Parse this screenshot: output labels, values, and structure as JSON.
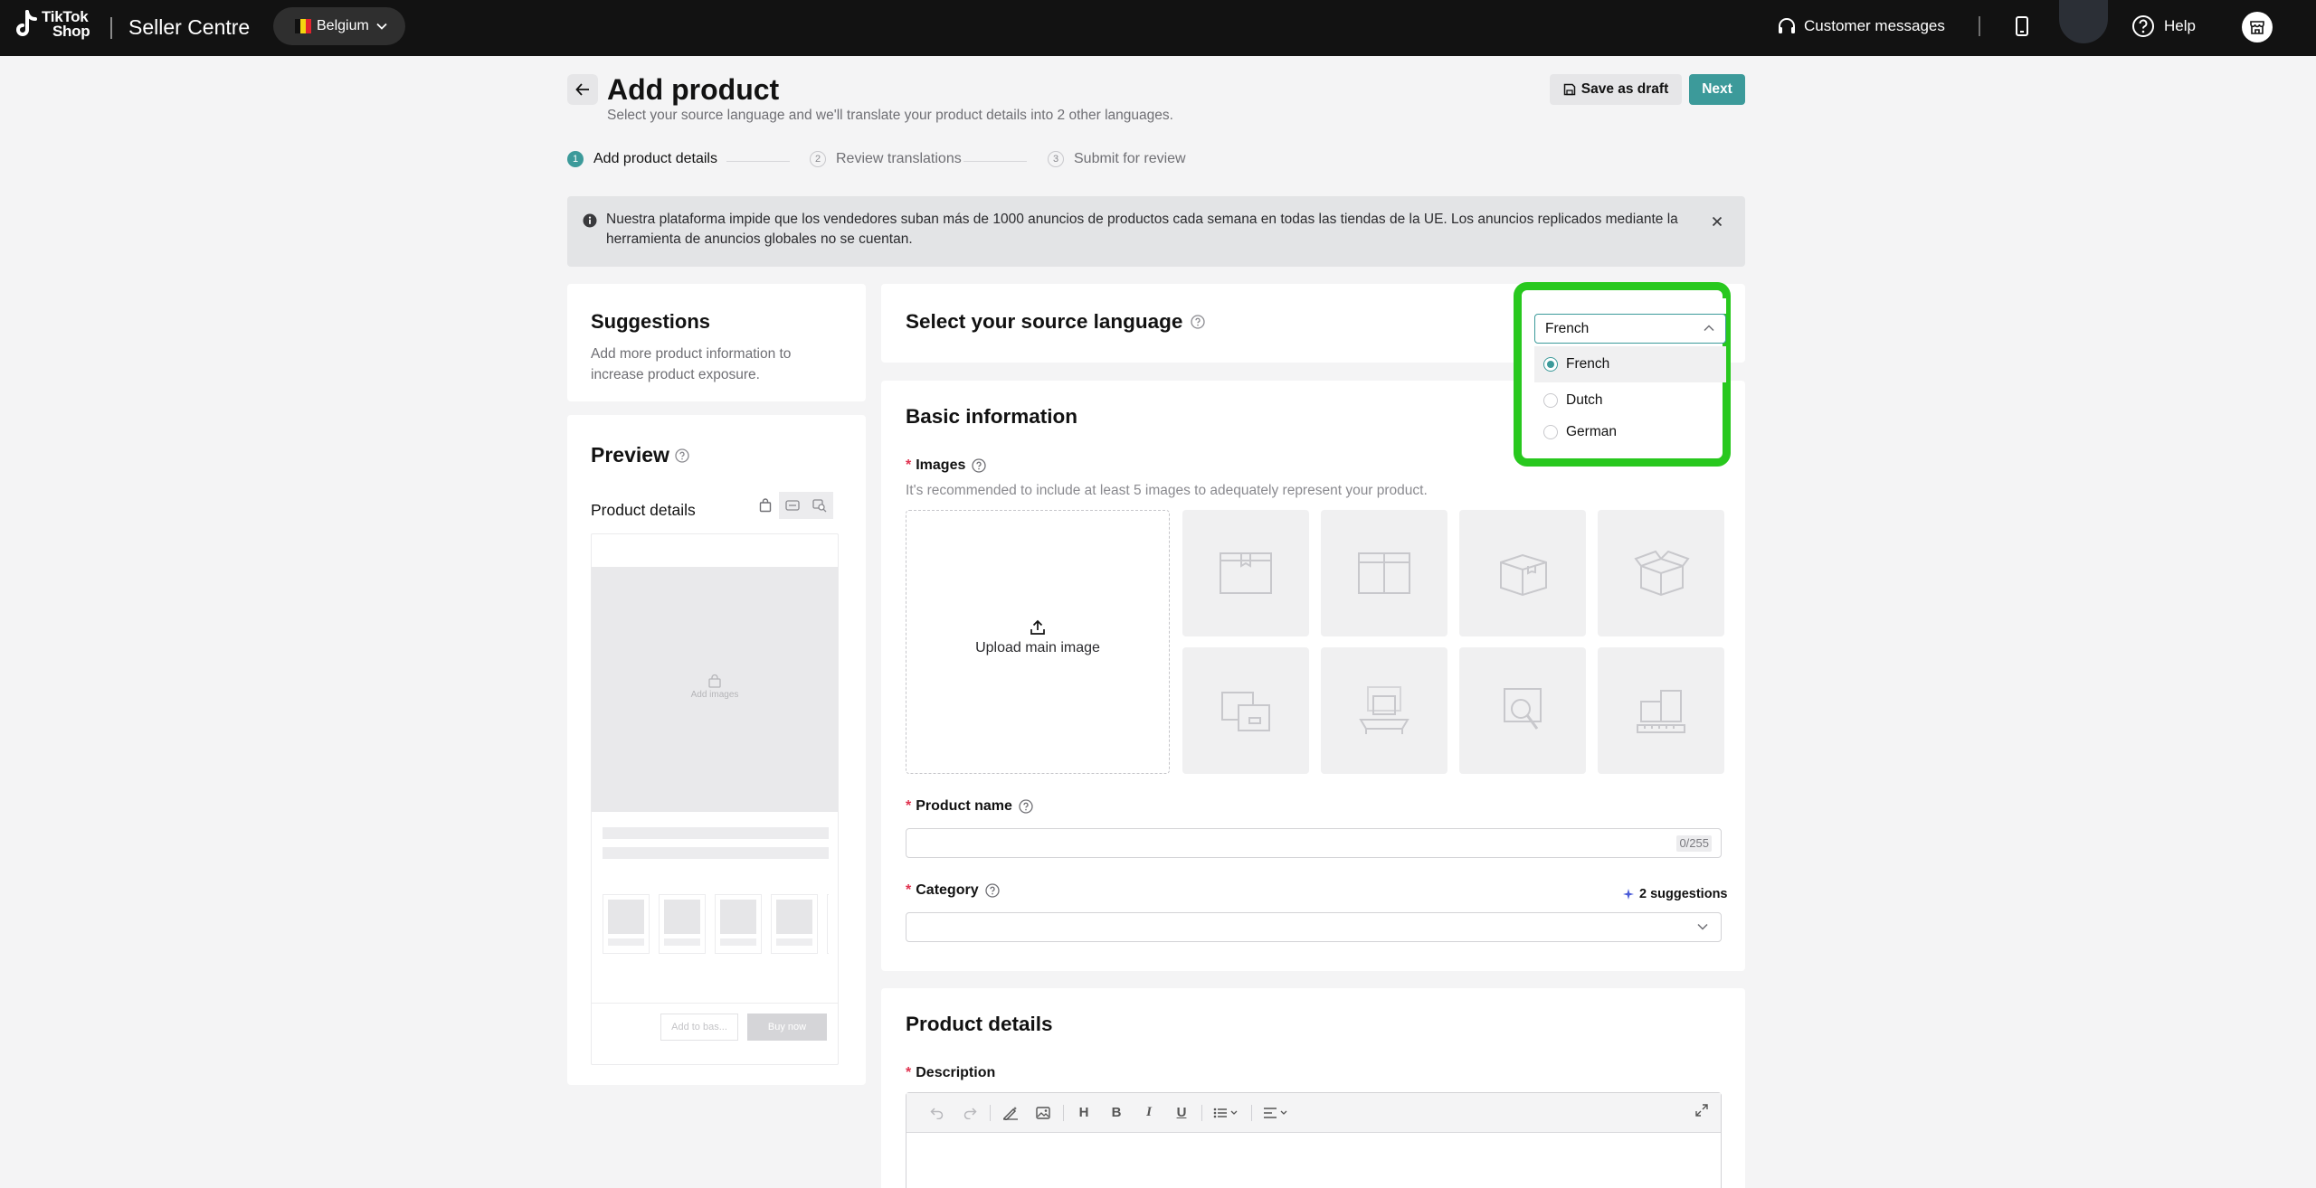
{
  "nav": {
    "logo_line1": "TikTok",
    "logo_line2": "Shop",
    "brand": "Seller Centre",
    "country": "Belgium",
    "customer_messages": "Customer messages",
    "help": "Help"
  },
  "header": {
    "title": "Add product",
    "subtitle": "Select your source language and we'll translate your product details into 2 other languages.",
    "save_draft": "Save as draft",
    "next": "Next"
  },
  "steps": [
    {
      "num": "1",
      "label": "Add product details",
      "state": "active"
    },
    {
      "num": "2",
      "label": "Review translations",
      "state": "todo"
    },
    {
      "num": "3",
      "label": "Submit for review",
      "state": "todo"
    }
  ],
  "notice": {
    "text": "Nuestra plataforma impide que los vendedores suban más de 1000 anuncios de productos cada semana en todas las tiendas de la UE. Los anuncios replicados mediante la herramienta de anuncios globales no se cuentan."
  },
  "suggestions": {
    "title": "Suggestions",
    "text": "Add more product information to increase product exposure."
  },
  "preview": {
    "title": "Preview",
    "product_details": "Product details",
    "add_images": "Add images",
    "add_to_basket": "Add to bas...",
    "buy_now": "Buy now"
  },
  "source_language": {
    "title": "Select your source language",
    "selected": "French",
    "options": [
      {
        "label": "French",
        "selected": true
      },
      {
        "label": "Dutch",
        "selected": false
      },
      {
        "label": "German",
        "selected": false
      }
    ]
  },
  "basic_info": {
    "title": "Basic information",
    "images_label": "Images",
    "images_hint": "It's recommended to include at least 5 images to adequately represent your product.",
    "upload_main": "Upload main image",
    "product_name_label": "Product name",
    "product_name_value": "",
    "product_name_counter": "0/255",
    "category_label": "Category",
    "category_suggestions": "2 suggestions",
    "category_value": ""
  },
  "product_details": {
    "title": "Product details",
    "description_label": "Description",
    "toolbar_heading": "H",
    "toolbar_bold": "B",
    "toolbar_italic": "I",
    "toolbar_underline": "U"
  },
  "colors": {
    "accent": "#3c9a9a",
    "required": "#e0324f",
    "highlight": "#28c81e",
    "topbar": "#121212"
  }
}
